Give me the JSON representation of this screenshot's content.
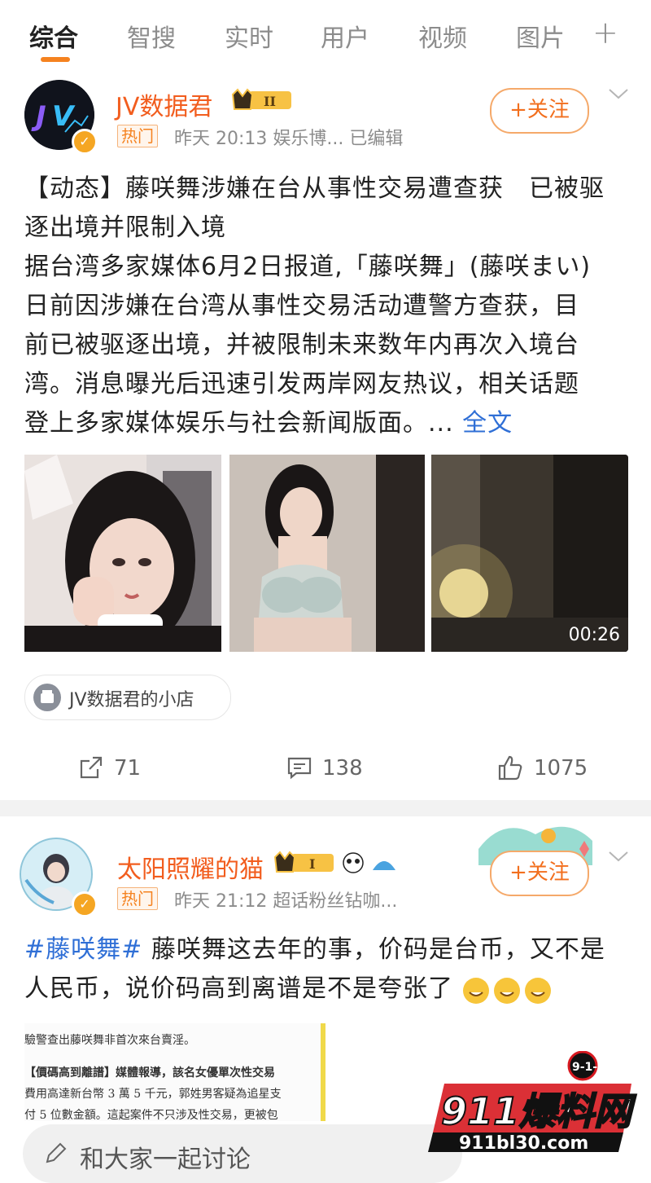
{
  "tabs": [
    {
      "label": "综合"
    },
    {
      "label": "智搜"
    },
    {
      "label": "实时"
    },
    {
      "label": "用户"
    },
    {
      "label": "视频"
    },
    {
      "label": "图片"
    }
  ],
  "tab_plus": "+",
  "post1": {
    "username": "JV数据君",
    "level": "II",
    "hot": "热门",
    "meta": "昨天 20:13  娱乐博...  已编辑",
    "follow": "+关注",
    "body_lines": [
      "【动态】藤咲舞涉嫌在台从事性交易遭查获　已被驱",
      "逐出境并限制入境",
      "据台湾多家媒体6月2日报道,「藤咲舞」(藤咲まい)",
      "日前因涉嫌在台湾从事性交易活动遭警方查获，目",
      "前已被驱逐出境，并被限制未来数年内再次入境台",
      "湾。消息曝光后迅速引发两岸网友热议，相关话题"
    ],
    "body_last": "登上多家媒体娱乐与社会新闻版面。...",
    "full_text": "全文",
    "video_duration": "00:26",
    "shop": "JV数据君的小店",
    "repost_count": "71",
    "comment_count": "138",
    "like_count": "1075"
  },
  "post2": {
    "username": "太阳照耀的猫",
    "level": "I",
    "hot": "热门",
    "meta": "昨天 21:12  超话粉丝钻咖...",
    "follow": "+关注",
    "hashtag": "#藤咲舞#",
    "body_line1": " 藤咲舞这去年的事，价码是台币，又不是",
    "body_line2": "人民币，说价码高到离谱是不是夸张了",
    "news_lines": [
      "驗警查出藤咲舞非首次來台賣淫。",
      "【價碼高到離譜】媒體報導，該名女優單次性交易",
      "費用高達新台幣 3 萬 5 千元，郭姓男客疑為追星支",
      "付 5 位數金額。這起案件不只涉及性交易，更被包"
    ]
  },
  "comment_placeholder": "和大家一起讨论",
  "watermark": {
    "brand": "911爆料网",
    "url": "911bl30.com",
    "badge": "9-1-1"
  },
  "colors": {
    "accent": "#f5821f",
    "username": "#f25d1e",
    "link": "#2f6fd6"
  },
  "icons": [
    "repost-icon",
    "comment-icon",
    "like-icon",
    "chevron-down-icon",
    "shop-icon",
    "edit-icon"
  ]
}
